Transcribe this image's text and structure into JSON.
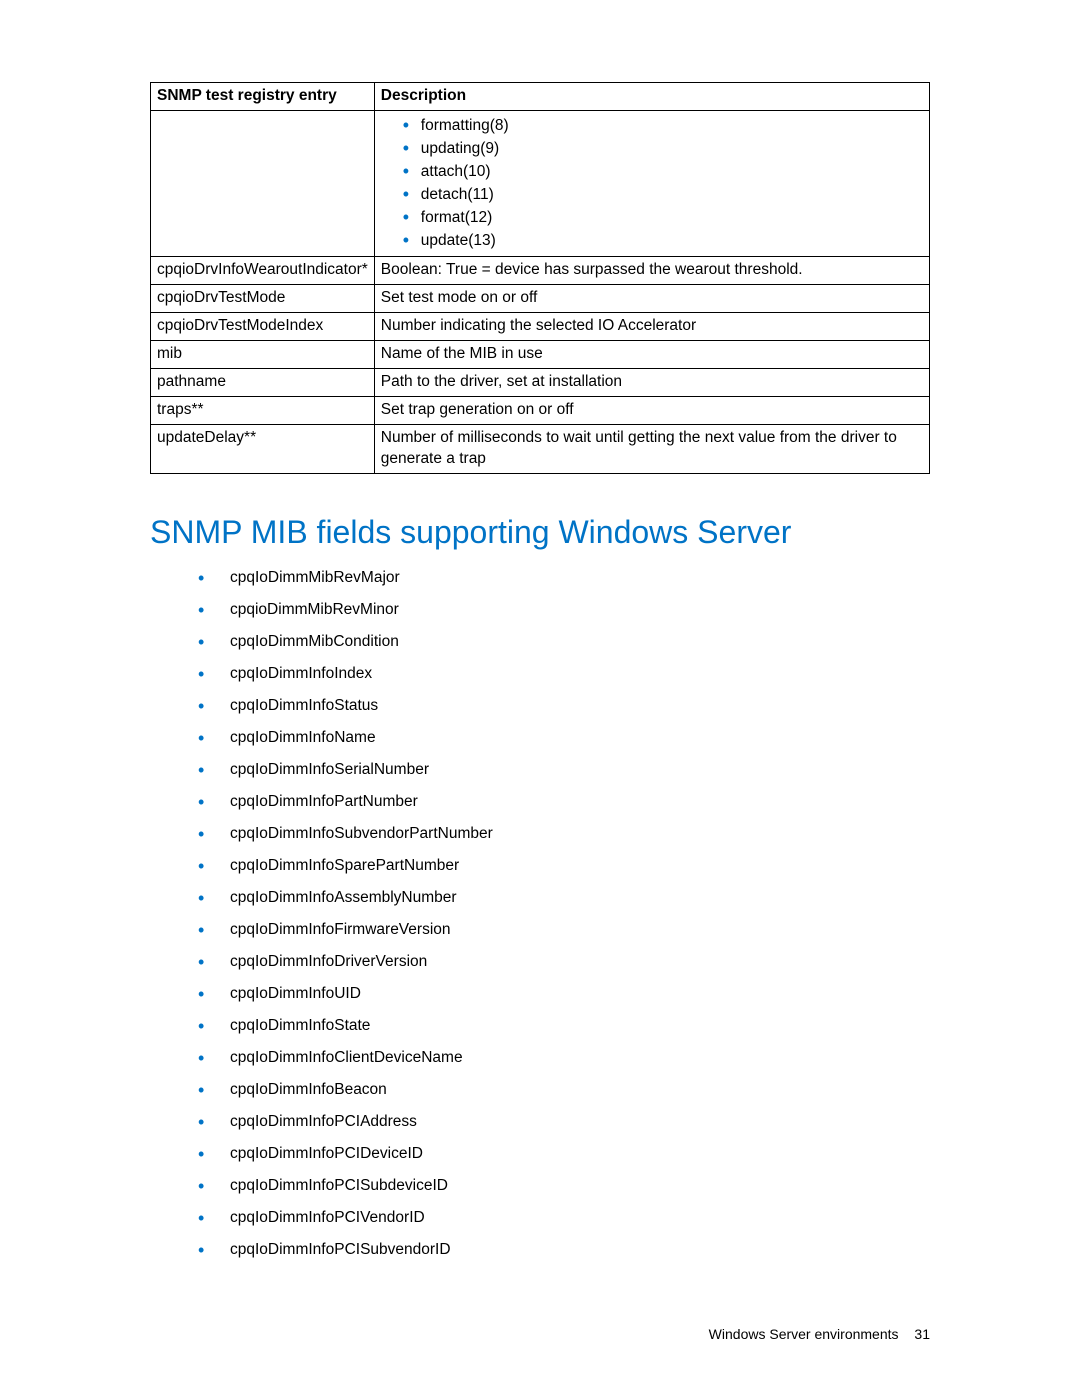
{
  "table": {
    "headers": {
      "entry": "SNMP test registry entry",
      "description": "Description"
    },
    "rows": [
      {
        "entry": "",
        "desc_list": [
          "formatting(8)",
          "updating(9)",
          "attach(10)",
          "detach(11)",
          "format(12)",
          "update(13)"
        ]
      },
      {
        "entry": "cpqioDrvInfoWearoutIndicator*",
        "desc": "Boolean: True = device has surpassed the wearout threshold."
      },
      {
        "entry": "cpqioDrvTestMode",
        "desc": "Set test mode on or off"
      },
      {
        "entry": "cpqioDrvTestModeIndex",
        "desc": "Number indicating the selected IO Accelerator"
      },
      {
        "entry": "mib",
        "desc": "Name of the MIB in use"
      },
      {
        "entry": "pathname",
        "desc": "Path to the driver, set at installation"
      },
      {
        "entry": "traps**",
        "desc": "Set trap generation on or off"
      },
      {
        "entry": "updateDelay**",
        "desc": "Number of milliseconds to wait until getting the next value from the driver to generate a trap"
      }
    ]
  },
  "section_heading": "SNMP MIB fields supporting Windows Server",
  "mib_fields": [
    "cpqIoDimmMibRevMajor",
    "cpqioDimmMibRevMinor",
    "cpqIoDimmMibCondition",
    "cpqIoDimmInfoIndex",
    "cpqIoDimmInfoStatus",
    "cpqIoDimmInfoName",
    "cpqIoDimmInfoSerialNumber",
    "cpqIoDimmInfoPartNumber",
    "cpqIoDimmInfoSubvendorPartNumber",
    "cpqIoDimmInfoSparePartNumber",
    "cpqIoDimmInfoAssemblyNumber",
    "cpqIoDimmInfoFirmwareVersion",
    "cpqIoDimmInfoDriverVersion",
    "cpqIoDimmInfoUID",
    "cpqIoDimmInfoState",
    "cpqIoDimmInfoClientDeviceName",
    "cpqIoDimmInfoBeacon",
    "cpqIoDimmInfoPCIAddress",
    "cpqIoDimmInfoPCIDeviceID",
    "cpqIoDimmInfoPCISubdeviceID",
    "cpqIoDimmInfoPCIVendorID",
    "cpqIoDimmInfoPCISubvendorID"
  ],
  "footer": {
    "section": "Windows Server environments",
    "page": "31"
  }
}
